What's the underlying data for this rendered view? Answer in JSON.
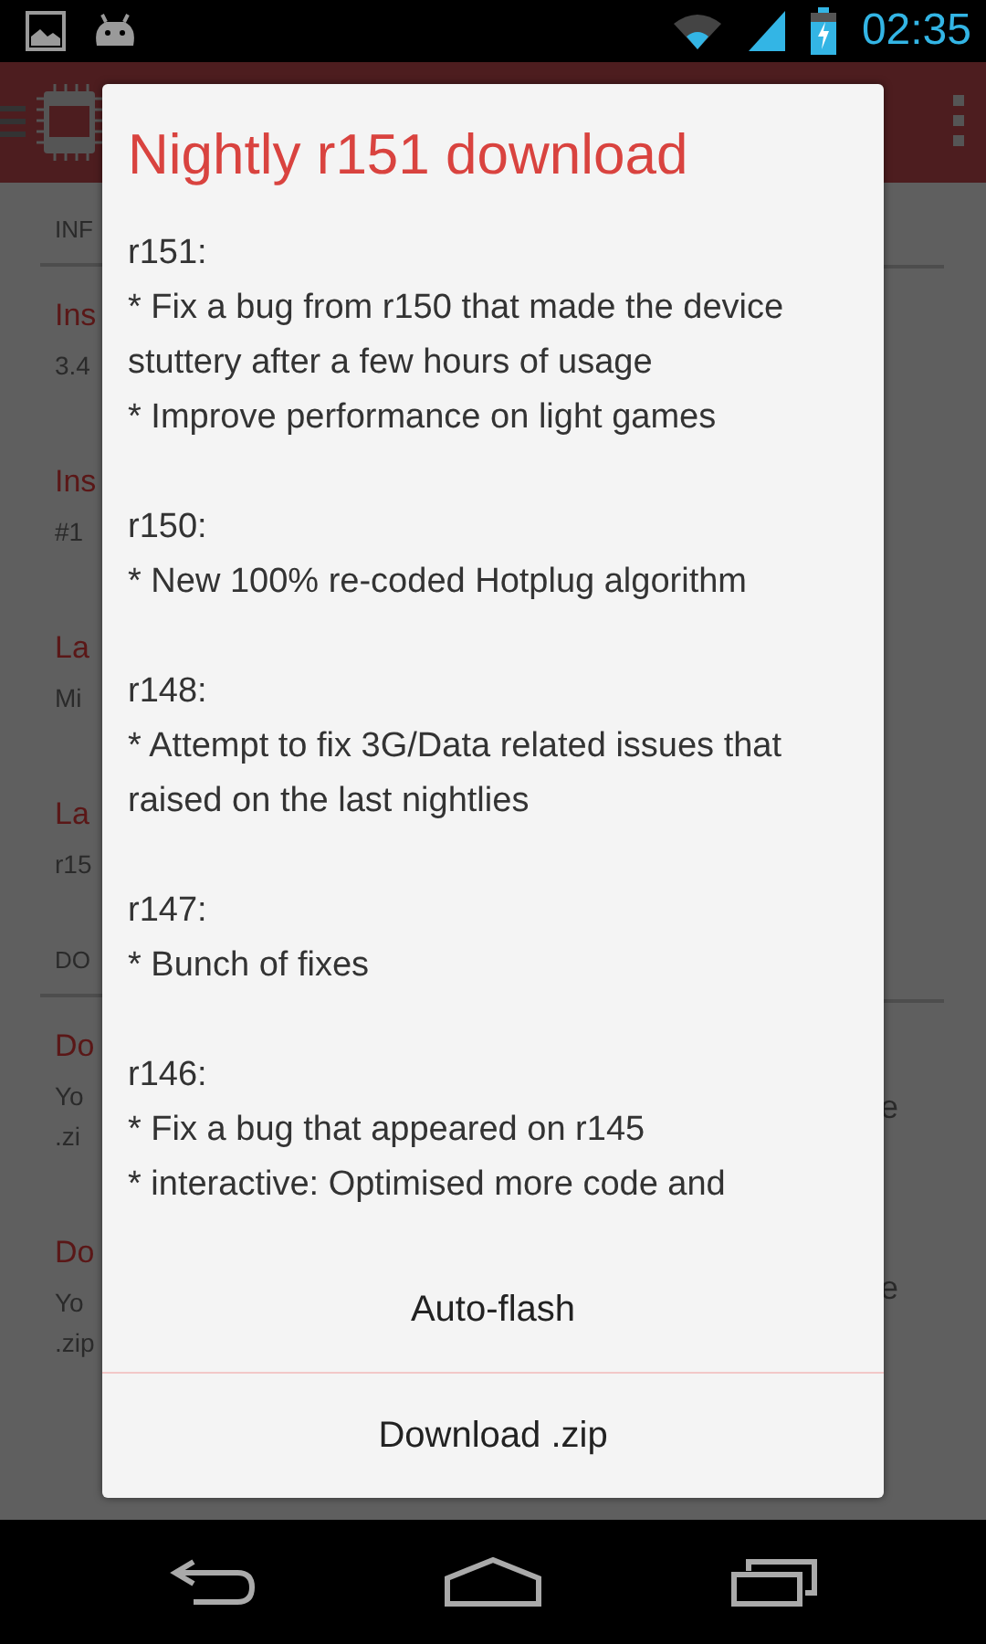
{
  "status_bar": {
    "time": "02:35"
  },
  "background": {
    "left": [
      {
        "kind": "header",
        "text": "INF"
      },
      {
        "kind": "title",
        "text": "Ins"
      },
      {
        "kind": "sub",
        "text": "3.4"
      },
      {
        "kind": "title",
        "text": "Ins"
      },
      {
        "kind": "sub",
        "text": "#1"
      },
      {
        "kind": "title",
        "text": "La"
      },
      {
        "kind": "sub",
        "text": "Mi"
      },
      {
        "kind": "title",
        "text": "La"
      },
      {
        "kind": "sub",
        "text": "r15"
      },
      {
        "kind": "header",
        "text": "DO"
      },
      {
        "kind": "title",
        "text": "Do"
      },
      {
        "kind": "sub",
        "text": "Yo"
      },
      {
        "kind": "sub",
        "text": ".zi"
      },
      {
        "kind": "title",
        "text": "Do"
      },
      {
        "kind": "sub",
        "text": "Yo"
      },
      {
        "kind": "sub",
        "text": ".zip"
      }
    ],
    "right": [
      "e",
      "e"
    ]
  },
  "dialog": {
    "title": "Nightly r151 download",
    "changelog": [
      {
        "version": "r151:",
        "items": [
          "* Fix a bug from r150 that made the device stuttery after a few hours of usage",
          "* Improve performance on light games"
        ]
      },
      {
        "version": "r150:",
        "items": [
          "* New 100% re-coded Hotplug algorithm"
        ]
      },
      {
        "version": "r148:",
        "items": [
          "* Attempt to fix 3G/Data related issues that raised on the last nightlies"
        ]
      },
      {
        "version": "r147:",
        "items": [
          "* Bunch of fixes"
        ]
      },
      {
        "version": "r146:",
        "items": [
          "* Fix a bug that appeared on r145",
          "* interactive: Optimised more code and"
        ]
      }
    ],
    "buttons": [
      "Auto-flash",
      "Download .zip"
    ]
  }
}
